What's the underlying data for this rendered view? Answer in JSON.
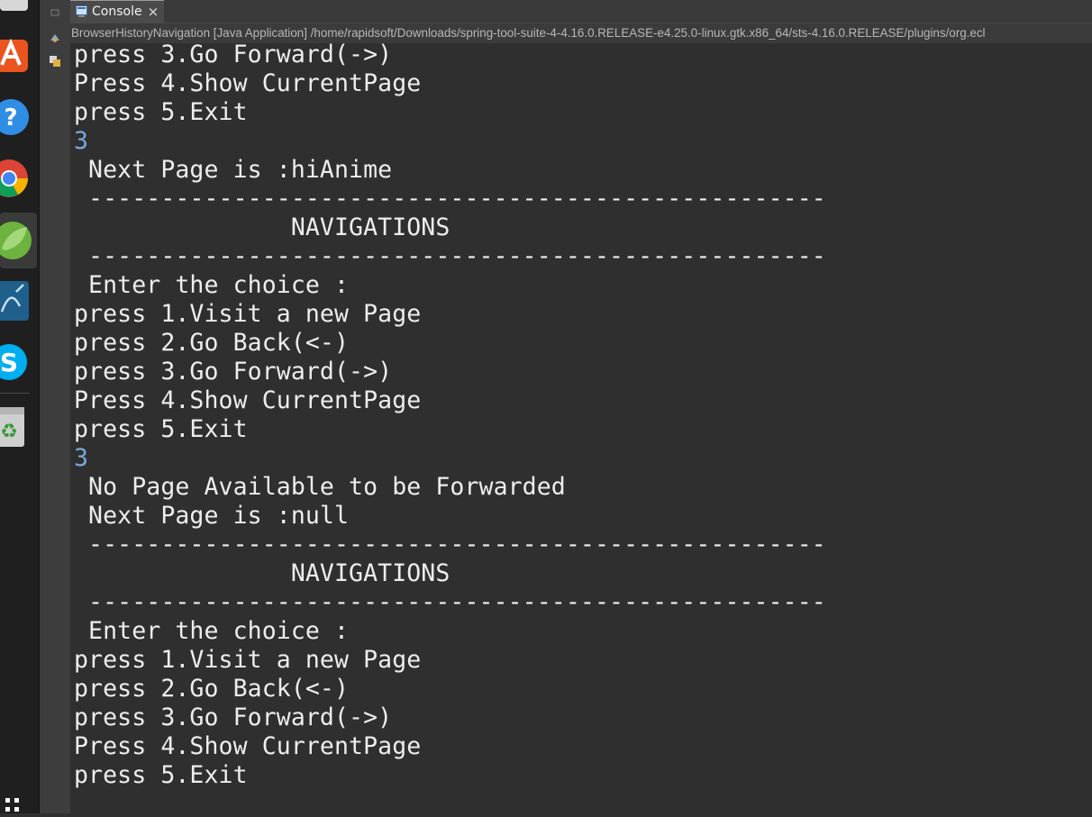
{
  "colors": {
    "background": "#2f2f2f",
    "text": "#ededed",
    "user_input": "#7aa6da",
    "tab_bg": "#4a4a4a"
  },
  "dock": {
    "icons": [
      "software-center-icon",
      "help-icon",
      "chrome-icon",
      "spring-tool-suite-icon",
      "mysql-workbench-icon",
      "skype-icon",
      "trash-icon",
      "app-grid-icon"
    ]
  },
  "tab": {
    "icon": "console-icon",
    "label": "Console",
    "close": "×"
  },
  "process_info": "BrowserHistoryNavigation [Java Application] /home/rapidsoft/Downloads/spring-tool-suite-4-4.16.0.RELEASE-e4.25.0-linux.gtk.x86_64/sts-4.16.0.RELEASE/plugins/org.ecl",
  "console": {
    "lines": [
      {
        "text": "press 3.Go Forward(->)",
        "input": false
      },
      {
        "text": "Press 4.Show CurrentPage",
        "input": false
      },
      {
        "text": "press 5.Exit",
        "input": false
      },
      {
        "text": "3",
        "input": true
      },
      {
        "text": " Next Page is :hiAnime",
        "input": false
      },
      {
        "text": " ---------------------------------------------------",
        "input": false
      },
      {
        "text": "               NAVIGATIONS",
        "input": false
      },
      {
        "text": " ---------------------------------------------------",
        "input": false
      },
      {
        "text": " Enter the choice :",
        "input": false
      },
      {
        "text": "press 1.Visit a new Page",
        "input": false
      },
      {
        "text": "press 2.Go Back(<-)",
        "input": false
      },
      {
        "text": "press 3.Go Forward(->)",
        "input": false
      },
      {
        "text": "Press 4.Show CurrentPage",
        "input": false
      },
      {
        "text": "press 5.Exit",
        "input": false
      },
      {
        "text": "3",
        "input": true
      },
      {
        "text": " No Page Available to be Forwarded",
        "input": false
      },
      {
        "text": " Next Page is :null",
        "input": false
      },
      {
        "text": " ---------------------------------------------------",
        "input": false
      },
      {
        "text": "               NAVIGATIONS",
        "input": false
      },
      {
        "text": " ---------------------------------------------------",
        "input": false
      },
      {
        "text": " Enter the choice :",
        "input": false
      },
      {
        "text": "press 1.Visit a new Page",
        "input": false
      },
      {
        "text": "press 2.Go Back(<-)",
        "input": false
      },
      {
        "text": "press 3.Go Forward(->)",
        "input": false
      },
      {
        "text": "Press 4.Show CurrentPage",
        "input": false
      },
      {
        "text": "press 5.Exit",
        "input": false
      }
    ]
  }
}
